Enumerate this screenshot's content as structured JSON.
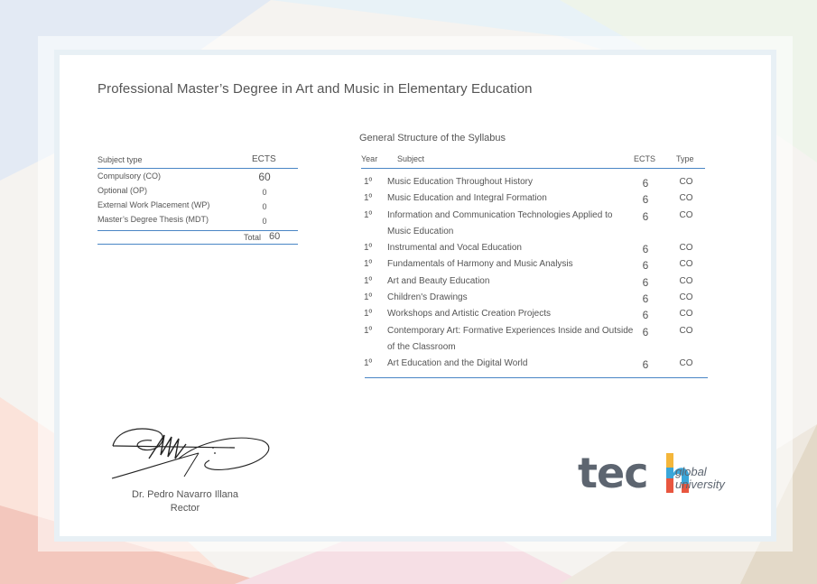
{
  "document": {
    "title": "Professional Master’s Degree in Art and Music in Elementary Education"
  },
  "summary_table": {
    "headers": {
      "subject_type": "Subject type",
      "ects": "ECTS"
    },
    "rows": [
      {
        "type": "Compulsory (CO)",
        "ects": "60"
      },
      {
        "type": "Optional (OP)",
        "ects": "0"
      },
      {
        "type": "External Work Placement (WP)",
        "ects": "0"
      },
      {
        "type": "Master’s Degree Thesis (MDT)",
        "ects": "0"
      }
    ],
    "total_label": "Total",
    "total_value": "60"
  },
  "syllabus": {
    "title": "General Structure of the Syllabus",
    "headers": {
      "year": "Year",
      "subject": "Subject",
      "ects": "ECTS",
      "type": "Type"
    },
    "rows": [
      {
        "year": "1º",
        "subject": "Music Education Throughout History",
        "ects": "6",
        "type": "CO"
      },
      {
        "year": "1º",
        "subject": "Music Education and Integral Formation",
        "ects": "6",
        "type": "CO"
      },
      {
        "year": "1º",
        "subject": "Information and Communication Technologies Applied to Music Education",
        "ects": "6",
        "type": "CO"
      },
      {
        "year": "1º",
        "subject": "Instrumental and Vocal Education",
        "ects": "6",
        "type": "CO"
      },
      {
        "year": "1º",
        "subject": "Fundamentals of Harmony and Music Analysis",
        "ects": "6",
        "type": "CO"
      },
      {
        "year": "1º",
        "subject": "Art and Beauty Education",
        "ects": "6",
        "type": "CO"
      },
      {
        "year": "1º",
        "subject": "Children's Drawings",
        "ects": "6",
        "type": "CO"
      },
      {
        "year": "1º",
        "subject": "Workshops and Artistic Creation Projects",
        "ects": "6",
        "type": "CO"
      },
      {
        "year": "1º",
        "subject": "Contemporary Art: Formative Experiences Inside and Outside of the Classroom",
        "ects": "6",
        "type": "CO"
      },
      {
        "year": "1º",
        "subject": "Art Education and the Digital World",
        "ects": "6",
        "type": "CO"
      }
    ]
  },
  "signatory": {
    "name": "Dr. Pedro Navarro Illana",
    "role": "Rector"
  },
  "logo": {
    "word": "tec",
    "line1": "global",
    "line2": "university",
    "icon": "tech-logo-icon",
    "colors": {
      "text": "#5d6570",
      "h_top": "#f4b63a",
      "h_mid": "#3aa6d9",
      "h_bot": "#e8563f"
    }
  },
  "colors": {
    "rule": "#4a86c5",
    "text": "#555555"
  }
}
